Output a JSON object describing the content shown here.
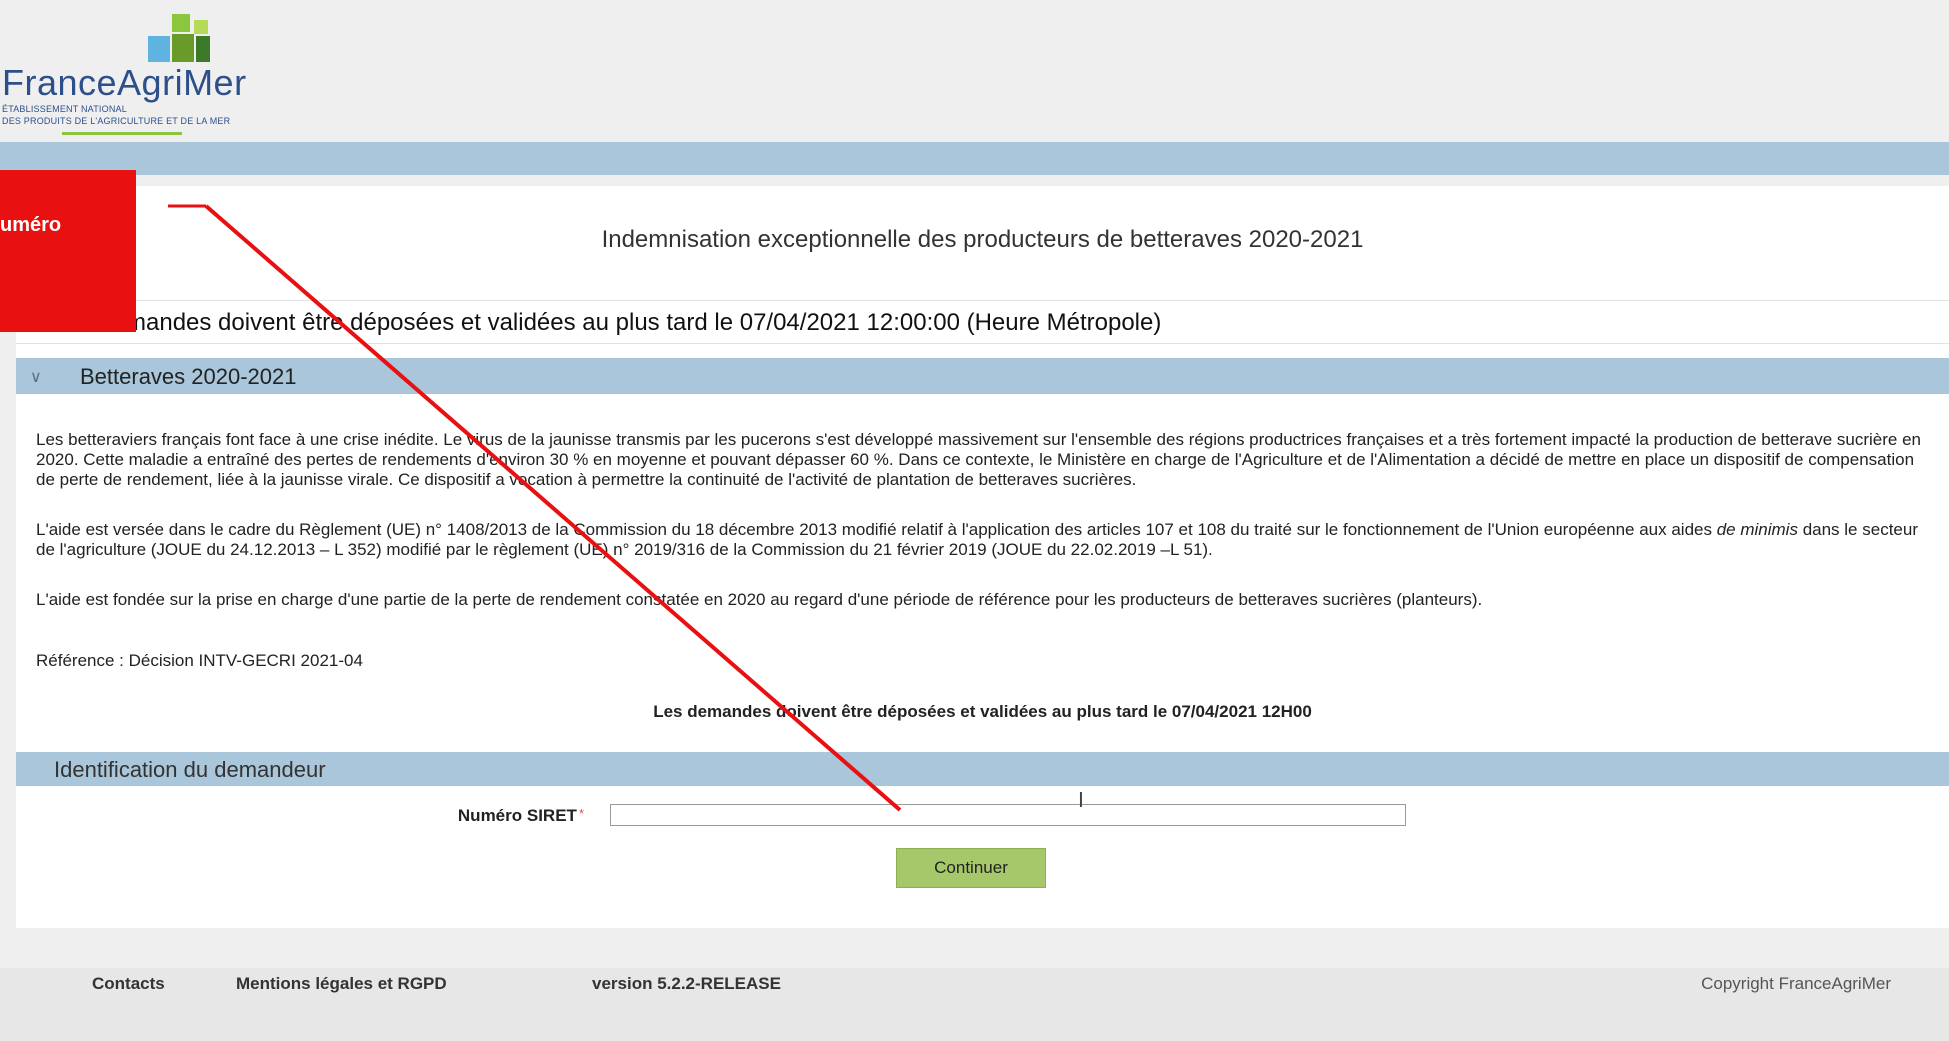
{
  "header": {
    "logo_name": "FranceAgriMer",
    "logo_subtitle_line1": "ÉTABLISSEMENT NATIONAL",
    "logo_subtitle_line2": "DES PRODUITS DE L'AGRICULTURE ET DE LA MER"
  },
  "page": {
    "title": "Indemnisation exceptionnelle des producteurs de betteraves 2020-2021",
    "deadline_banner": "mandes doivent être déposées et validées au plus tard le 07/04/2021 12:00:00 (Heure Métropole)"
  },
  "section_betteraves": {
    "title": "Betteraves 2020-2021",
    "icon": "chevron-down-icon",
    "paragraphs": [
      "Les betteraviers français font face à une crise inédite. Le virus de la jaunisse transmis par les pucerons s'est développé massivement sur l'ensemble des régions productrices françaises et a très fortement impacté la production de betterave sucrière en 2020. Cette maladie a entraîné des pertes de rendements d'environ 30 % en moyenne et pouvant dépasser 60 %. Dans ce contexte, le Ministère en charge de l'Agriculture et de l'Alimentation a décidé de mettre en place un dispositif de compensation de perte de rendement, liée à la jaunisse virale. Ce dispositif a vocation à permettre la continuité de l'activité de plantation de betteraves sucrières.",
      "L'aide est fondée sur la prise en charge d'une partie de la perte de rendement constatée en 2020 au regard d'une période de référence pour les producteurs de betteraves sucrières (planteurs).",
      "Référence : Décision INTV-GECRI 2021-04"
    ],
    "p2_before": "L'aide est versée dans le cadre du Règlement (UE) n° 1408/2013 de la Commission du 18 décembre 2013 modifié relatif à l'application des articles 107 et 108 du traité sur le fonctionnement de l'Union européenne aux aides ",
    "p2_italic": "de minimis",
    "p2_after": " dans le secteur de l'agriculture (JOUE du 24.12.2013 – L 352) modifié par le règlement (UE) n° 2019/316 de la Commission du 21 février 2019 (JOUE du 22.02.2019 –L 51).",
    "deadline_bold": "Les demandes doivent être déposées et validées au plus tard le 07/04/2021 12H00"
  },
  "section_identification": {
    "title": "Identification du demandeur",
    "siret_label": "Numéro SIRET",
    "siret_required_mark": "*",
    "siret_value": "",
    "continue_label": "Continuer"
  },
  "footer": {
    "contacts": "Contacts",
    "legal": "Mentions légales et RGPD",
    "version": "version 5.2.2-RELEASE",
    "copyright": "Copyright FranceAgriMer"
  },
  "annotation": {
    "callout_text": "uméro",
    "color": "#e81010"
  },
  "colors": {
    "section_bar": "#a9c6da",
    "button": "#a6c86b",
    "logo_green": "#8cc63f",
    "logo_blue": "#2d4f8a"
  }
}
